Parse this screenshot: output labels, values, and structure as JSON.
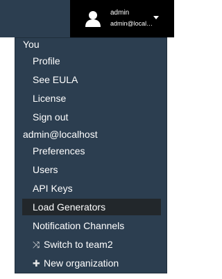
{
  "user": {
    "name": "admin",
    "email": "admin@localhost",
    "avatar_icon": "user-icon",
    "dropdown_icon": "caret-down-icon"
  },
  "menu": {
    "section_you": "You",
    "you_items": [
      {
        "label": "Profile"
      },
      {
        "label": "See EULA"
      },
      {
        "label": "License"
      },
      {
        "label": "Sign out"
      }
    ],
    "section_org": "admin@localhost",
    "org_items": [
      {
        "label": "Preferences"
      },
      {
        "label": "Users"
      },
      {
        "label": "API Keys"
      },
      {
        "label": "Load Generators",
        "active": true
      },
      {
        "label": "Notification Channels"
      }
    ],
    "switch_label": "Switch to team2",
    "switch_icon": "shuffle-icon",
    "new_org_label": "New organization",
    "new_org_icon": "plus-icon"
  },
  "colors": {
    "topbar": "#2c3e50",
    "menu_background": "#2c3e50",
    "user_button": "#000000",
    "active_item": "#22272b",
    "text": "#ffffff"
  }
}
